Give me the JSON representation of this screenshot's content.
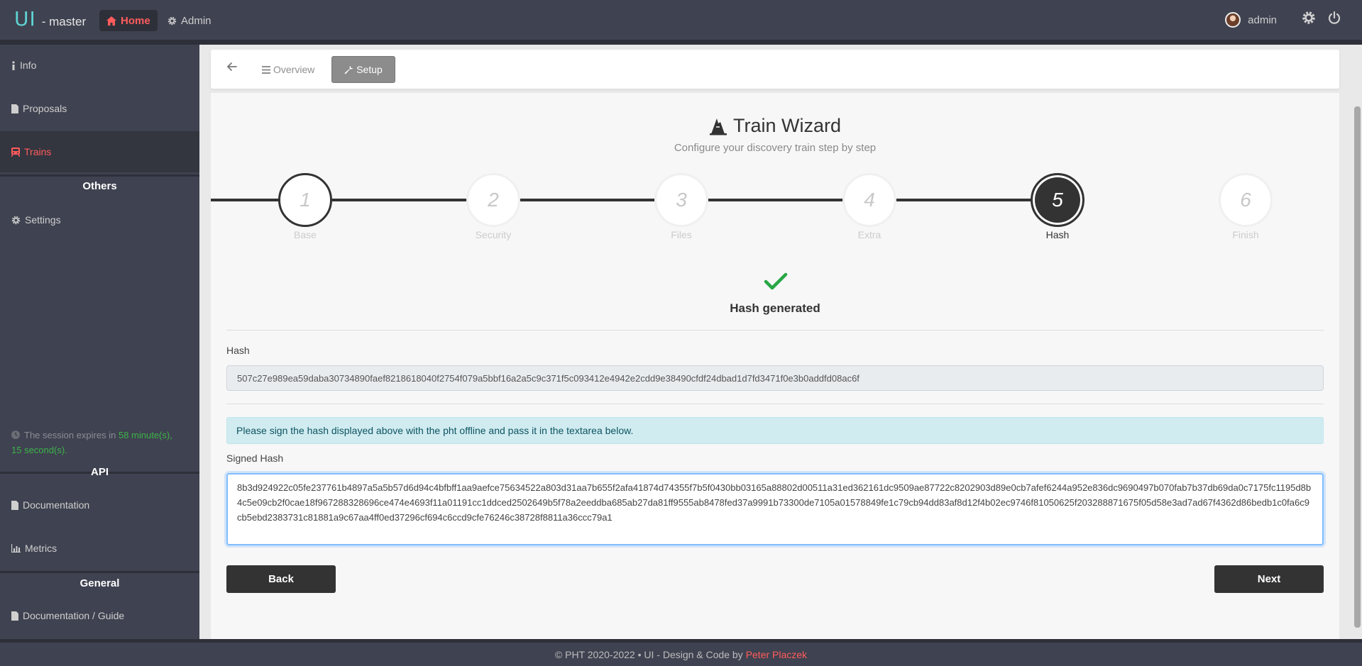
{
  "brand": {
    "logo": "UI",
    "branch": "- master"
  },
  "topnav": {
    "home_label": "Home",
    "admin_label": "Admin"
  },
  "user": {
    "name": "admin"
  },
  "sidebar": {
    "items": [
      {
        "label": "Info"
      },
      {
        "label": "Proposals"
      },
      {
        "label": "Trains"
      }
    ],
    "others_header": "Others",
    "settings_label": "Settings",
    "session": {
      "prefix": "The session expires in",
      "time": "58 minute(s), 15 second(s)."
    },
    "api_header": "API",
    "api_items": [
      {
        "label": "Documentation"
      },
      {
        "label": "Metrics"
      }
    ],
    "general_header": "General",
    "general_items": [
      {
        "label": "Documentation / Guide"
      }
    ]
  },
  "toolbar": {
    "overview_label": "Overview",
    "setup_label": "Setup"
  },
  "wizard": {
    "title": "Train Wizard",
    "subtitle": "Configure your discovery train step by step",
    "steps": [
      {
        "number": "1",
        "label": "Base"
      },
      {
        "number": "2",
        "label": "Security"
      },
      {
        "number": "3",
        "label": "Files"
      },
      {
        "number": "4",
        "label": "Extra"
      },
      {
        "number": "5",
        "label": "Hash"
      },
      {
        "number": "6",
        "label": "Finish"
      }
    ],
    "current_step": 5
  },
  "hash_section": {
    "status": "Hash generated",
    "hash_label": "Hash",
    "hash_value": "507c27e989ea59daba30734890faef8218618040f2754f079a5bbf16a2a5c9c371f5c093412e4942e2cdd9e38490cfdf24dbad1d7fd3471f0e3b0addfd08ac6f",
    "info_text": "Please sign the hash displayed above with the pht offline and pass it in the textarea below.",
    "signed_label": "Signed Hash",
    "signed_value": "8b3d924922c05fe237761b4897a5a5b57d6d94c4bfbff1aa9aefce75634522a803d31aa7b655f2afa41874d74355f7b5f0430bb03165a88802d00511a31ed362161dc9509ae87722c8202903d89e0cb7afef6244a952e836dc9690497b070fab7b37db69da0c7175fc1195d8b4c5e09cb2f0cae18f967288328696ce474e4693f11a01191cc1ddced2502649b5f78a2eeddba685ab27da81ff9555ab8478fed37a9991b73300de7105a01578849fe1c79cb94dd83af8d12f4b02ec9746f81050625f203288871675f05d58e3ad7ad67f4362d86bedb1c0fa6c9cb5ebd2383731c81881a9c67aa4ff0ed37296cf694c6ccd9cfe76246c38728f8811a36ccc79a1",
    "back_label": "Back",
    "next_label": "Next"
  },
  "footer": {
    "text": "© PHT 2020-2022 • UI - Design & Code by",
    "author": "Peter Placzek"
  },
  "colors": {
    "accent": "#ff5c5c",
    "dark": "#333333",
    "sidebar_bg": "#3f4250",
    "success": "#28a745"
  }
}
